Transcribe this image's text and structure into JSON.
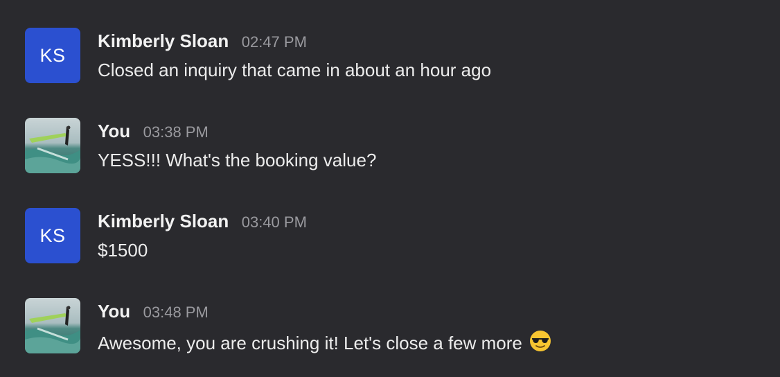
{
  "colors": {
    "background": "#2a2a2e",
    "avatar_initials_bg": "#2b50d0",
    "sender_text": "#f2f2f2",
    "timestamp_text": "#9a9a9f",
    "body_text": "#ececec"
  },
  "messages": [
    {
      "sender": "Kimberly Sloan",
      "time": "02:47 PM",
      "text": "Closed an inquiry that came in about an hour ago",
      "avatar": {
        "type": "initials",
        "initials": "KS"
      }
    },
    {
      "sender": "You",
      "time": "03:38 PM",
      "text": "YESS!!! What's the booking value?",
      "avatar": {
        "type": "photo",
        "icon": "windsurfer-photo-icon"
      }
    },
    {
      "sender": "Kimberly Sloan",
      "time": "03:40 PM",
      "text": "$1500",
      "avatar": {
        "type": "initials",
        "initials": "KS"
      }
    },
    {
      "sender": "You",
      "time": "03:48 PM",
      "text": "Awesome, you are crushing it! Let's close a few more",
      "emoji": "sunglasses-emoji-icon",
      "avatar": {
        "type": "photo",
        "icon": "windsurfer-photo-icon"
      }
    }
  ]
}
